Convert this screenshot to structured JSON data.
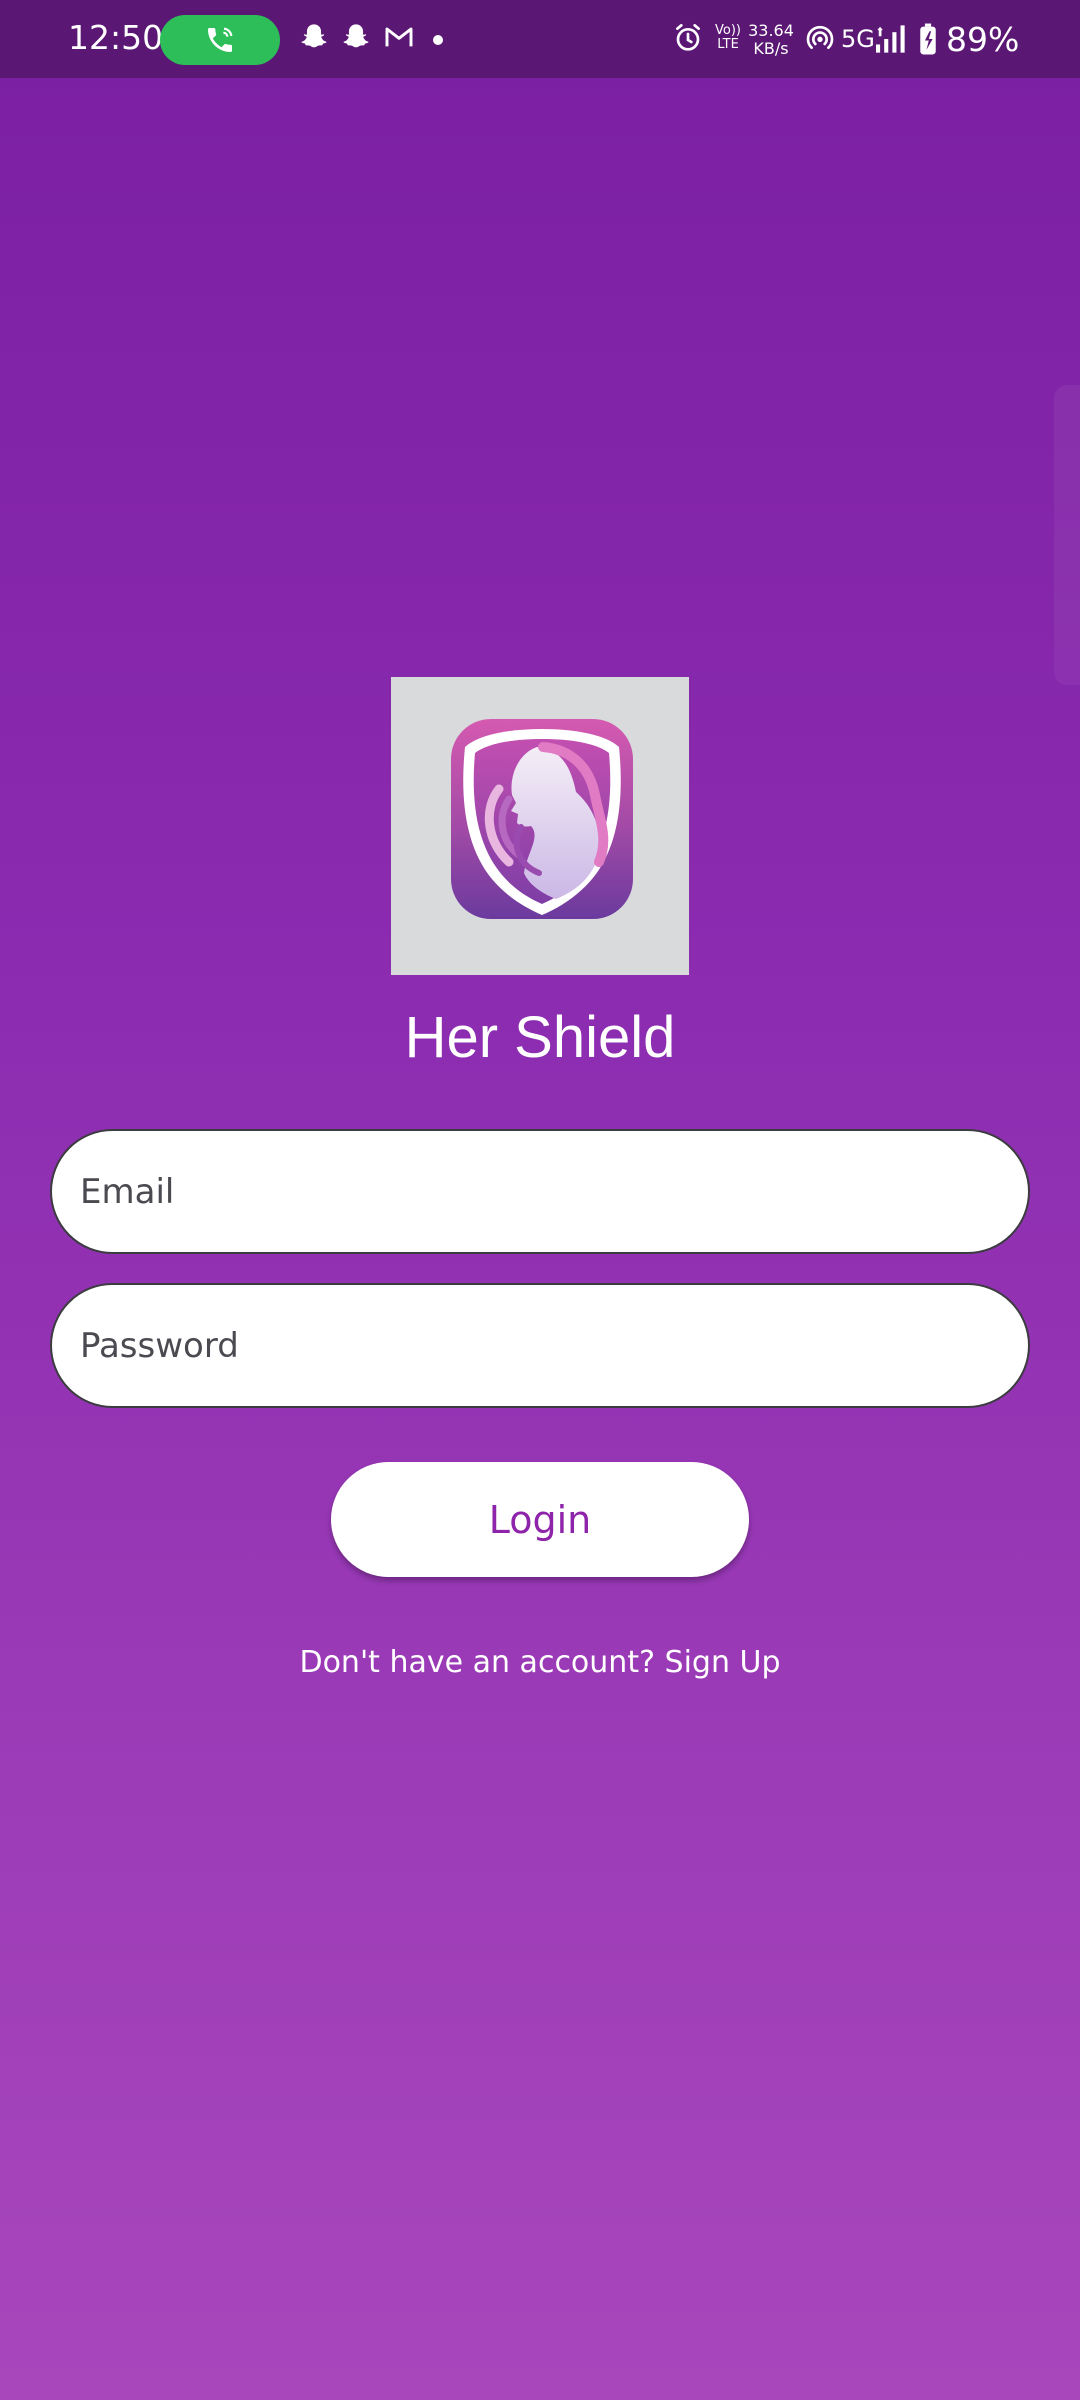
{
  "status_bar": {
    "time": "12:50",
    "network_speed_value": "33.64",
    "network_speed_unit": "KB/s",
    "volte_top": "Vo))",
    "volte_bottom": "LTE",
    "network_type": "5G",
    "battery_percent": "89%",
    "icons": [
      "phone-call-icon",
      "snapchat-icon",
      "snapchat-icon",
      "gmail-icon",
      "alarm-icon",
      "hotspot-icon",
      "signal-icon",
      "battery-charging-icon"
    ],
    "call_pill_color": "#2DBE5A"
  },
  "app": {
    "title": "Her Shield",
    "logo": "woman-shield-logo"
  },
  "login_form": {
    "email_placeholder": "Email",
    "password_placeholder": "Password",
    "login_label": "Login",
    "signup_prompt": "Don't have an account? Sign Up"
  },
  "colors": {
    "background_top": "#7B1FA2",
    "background_bottom": "#A847BC",
    "accent": "#8E24AA",
    "status_bar": "#5B1774"
  }
}
